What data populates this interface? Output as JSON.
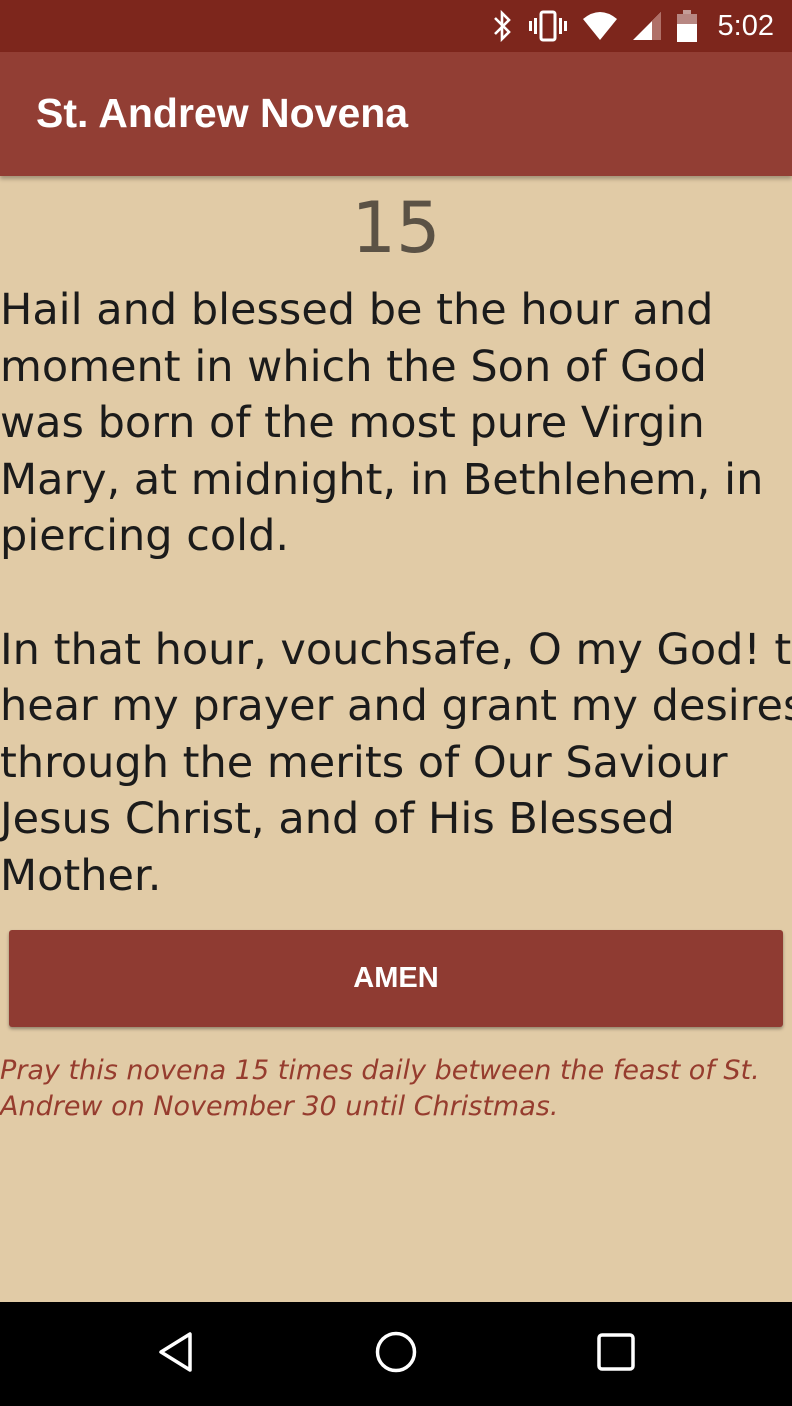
{
  "status_bar": {
    "time": "5:02",
    "icons": [
      "bluetooth-icon",
      "vibrate-icon",
      "wifi-icon",
      "cell-signal-icon",
      "battery-icon"
    ]
  },
  "app_bar": {
    "title": "St. Andrew Novena"
  },
  "main": {
    "counter": "15",
    "prayer_paragraph_1": [
      "Hail and blessed be the hour and",
      "moment in which the Son of God",
      "was born of the most pure Virgin",
      "Mary, at midnight, in Bethlehem, in",
      "piercing cold."
    ],
    "prayer_paragraph_2": [
      "In that hour, vouchsafe, O my God! to",
      "hear my prayer and grant my desires,",
      "through the merits of Our Saviour",
      "Jesus Christ, and of His Blessed",
      "Mother."
    ],
    "amen_label": "AMEN",
    "instructions": [
      "Pray this novena 15 times daily between the feast of St.",
      "Andrew on November 30 until Christmas."
    ]
  },
  "nav_bar": {
    "buttons": [
      "back-icon",
      "home-icon",
      "recents-icon"
    ]
  },
  "colors": {
    "status_bar": "#7d261c",
    "app_bar": "#923e34",
    "background": "#e1cba6",
    "button": "#8f3b32",
    "accent_text": "#963c2e"
  }
}
